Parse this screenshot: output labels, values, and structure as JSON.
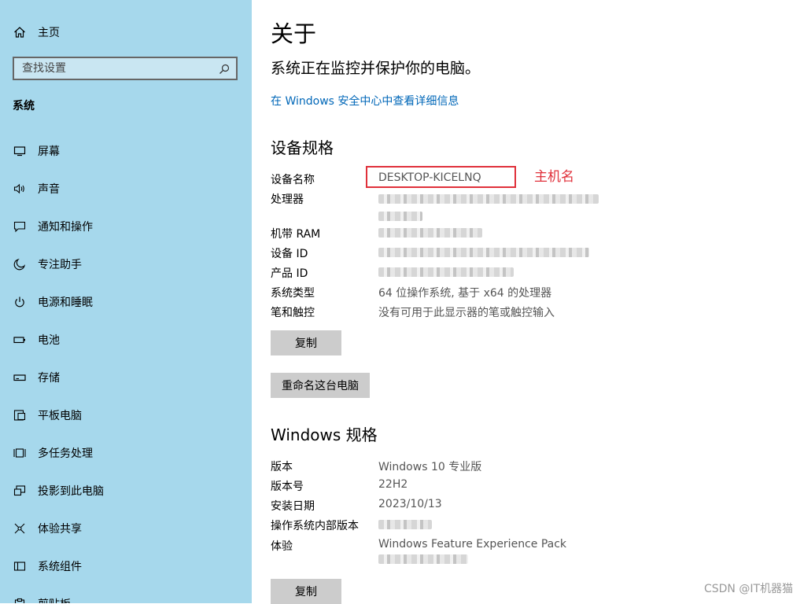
{
  "sidebar": {
    "home_label": "主页",
    "search_placeholder": "查找设置",
    "section_label": "系统",
    "items": [
      {
        "label": "屏幕",
        "icon": "monitor-icon"
      },
      {
        "label": "声音",
        "icon": "speaker-icon"
      },
      {
        "label": "通知和操作",
        "icon": "notification-icon"
      },
      {
        "label": "专注助手",
        "icon": "moon-icon"
      },
      {
        "label": "电源和睡眠",
        "icon": "power-icon"
      },
      {
        "label": "电池",
        "icon": "battery-icon"
      },
      {
        "label": "存储",
        "icon": "storage-icon"
      },
      {
        "label": "平板电脑",
        "icon": "tablet-icon"
      },
      {
        "label": "多任务处理",
        "icon": "multitask-icon"
      },
      {
        "label": "投影到此电脑",
        "icon": "project-icon"
      },
      {
        "label": "体验共享",
        "icon": "share-icon"
      },
      {
        "label": "系统组件",
        "icon": "components-icon"
      },
      {
        "label": "剪贴板",
        "icon": "clipboard-icon"
      }
    ]
  },
  "main": {
    "title": "关于",
    "status": "系统正在监控并保护你的电脑。",
    "security_link": "在 Windows 安全中心中查看详细信息",
    "device_specs": {
      "title": "设备规格",
      "rows": [
        {
          "label": "设备名称",
          "value": "DESKTOP-KICELNQ"
        },
        {
          "label": "处理器",
          "value": ""
        },
        {
          "label": "机带 RAM",
          "value": ""
        },
        {
          "label": "设备 ID",
          "value": ""
        },
        {
          "label": "产品 ID",
          "value": ""
        },
        {
          "label": "系统类型",
          "value": "64 位操作系统, 基于 x64 的处理器"
        },
        {
          "label": "笔和触控",
          "value": "没有可用于此显示器的笔或触控输入"
        }
      ],
      "copy_button": "复制",
      "rename_button": "重命名这台电脑"
    },
    "windows_specs": {
      "title": "Windows 规格",
      "rows": [
        {
          "label": "版本",
          "value": "Windows 10 专业版"
        },
        {
          "label": "版本号",
          "value": "22H2"
        },
        {
          "label": "安装日期",
          "value": "2023/10/13"
        },
        {
          "label": "操作系统内部版本",
          "value": ""
        },
        {
          "label": "体验",
          "value": "Windows Feature Experience Pack"
        }
      ],
      "copy_button": "复制"
    },
    "annotation": "主机名",
    "watermark": "CSDN @IT机器猫"
  },
  "colors": {
    "sidebar_bg": "#a6d8ec",
    "link": "#0067b8",
    "annotation": "#e0303a",
    "button_bg": "#cccccc"
  }
}
